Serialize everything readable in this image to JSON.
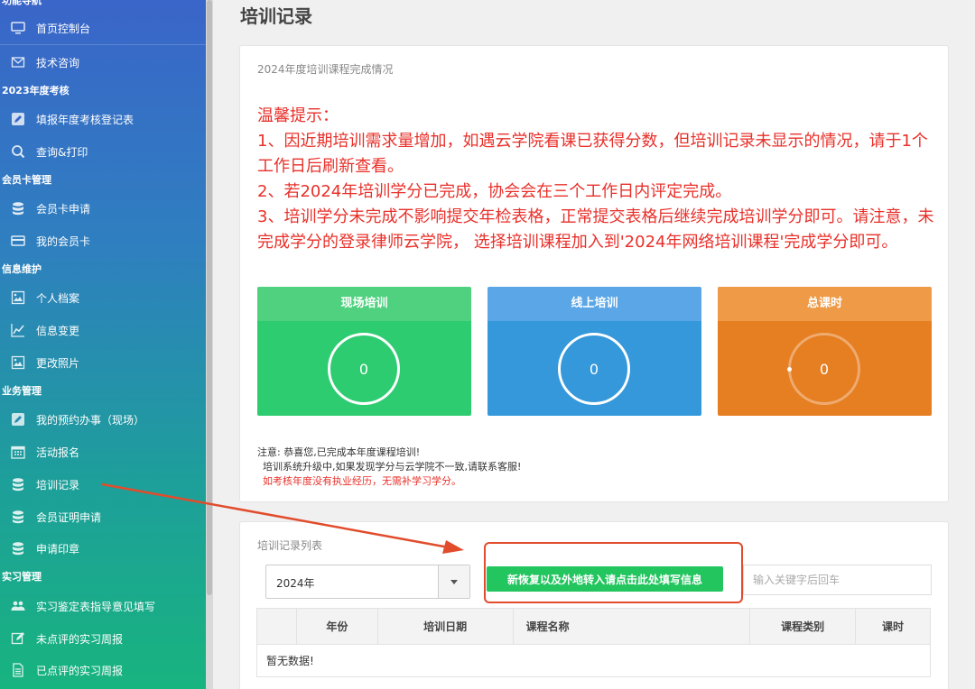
{
  "sidebar": {
    "sections": [
      {
        "label": "功能导航"
      },
      {
        "label": "2023年度考核"
      },
      {
        "label": "会员卡管理"
      },
      {
        "label": "信息维护"
      },
      {
        "label": "业务管理"
      },
      {
        "label": "实习管理"
      }
    ],
    "items": [
      {
        "label": "首页控制台",
        "icon": "monitor-icon"
      },
      {
        "label": "技术咨询",
        "icon": "envelope-icon"
      },
      {
        "label": "填报年度考核登记表",
        "icon": "edit-icon"
      },
      {
        "label": "查询&打印",
        "icon": "search-icon"
      },
      {
        "label": "会员卡申请",
        "icon": "database-icon"
      },
      {
        "label": "我的会员卡",
        "icon": "card-icon"
      },
      {
        "label": "个人档案",
        "icon": "image-icon"
      },
      {
        "label": "信息变更",
        "icon": "chart-icon"
      },
      {
        "label": "更改照片",
        "icon": "image-icon"
      },
      {
        "label": "我的预约办事（现场）",
        "icon": "edit-icon"
      },
      {
        "label": "活动报名",
        "icon": "calendar-icon"
      },
      {
        "label": "培训记录",
        "icon": "database-icon"
      },
      {
        "label": "会员证明申请",
        "icon": "database-icon"
      },
      {
        "label": "申请印章",
        "icon": "database-icon"
      },
      {
        "label": "实习鉴定表指导意见填写",
        "icon": "users-icon"
      },
      {
        "label": "未点评的实习周报",
        "icon": "edit-icon"
      },
      {
        "label": "已点评的实习周报",
        "icon": "document-icon"
      }
    ]
  },
  "page": {
    "title": "培训记录"
  },
  "summary": {
    "heading": "2024年度培训课程完成情况",
    "notice": [
      "温馨提示：",
      "1、因近期培训需求量增加，如遇云学院看课已获得分数，但培训记录未显示的情况，请于1个工作日后刷新查看。",
      "2、若2024年培训学分已完成，协会会在三个工作日内评定完成。",
      "3、培训学分未完成不影响提交年检表格，正常提交表格后继续完成培训学分即可。请注意，未完成学分的登录律师云学院， 选择培训课程加入到'2024年网络培训课程'完成学分即可。"
    ],
    "cards": [
      {
        "title": "现场培训",
        "value": "0",
        "header_color": "#4fd17f",
        "body_color": "#2ecc71"
      },
      {
        "title": "线上培训",
        "value": "0",
        "header_color": "#5aa6e6",
        "body_color": "#3498db"
      },
      {
        "title": "总课时",
        "value": "0",
        "header_color": "#ee9a47",
        "body_color": "#e67e22"
      }
    ],
    "notes": [
      "注意: 恭喜您,已完成本年度课程培训!",
      "培训系统升级中,如果发现学分与云学院不一致,请联系客服!",
      "如考核年度没有执业经历，无需补学习学分。"
    ]
  },
  "list": {
    "heading": "培训记录列表",
    "year_select": "2024年",
    "transfer_button": "新恢复以及外地转入请点击此处填写信息",
    "search_placeholder": "输入关键字后回车",
    "columns": [
      "",
      "年份",
      "培训日期",
      "课程名称",
      "课程类别",
      "课时"
    ],
    "empty_text": "暂无数据!"
  },
  "colors": {
    "notice_red": "#e8302a",
    "button_green": "#22c55e",
    "annotation_red": "#e14c2c"
  }
}
